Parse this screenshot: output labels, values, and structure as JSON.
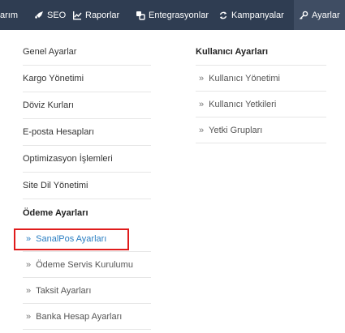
{
  "nav": {
    "items": [
      {
        "label": "arım",
        "icon": ""
      },
      {
        "label": "SEO",
        "icon": "rocket-icon"
      },
      {
        "label": "Raporlar",
        "icon": "chart-icon"
      },
      {
        "label": "Entegrasyonlar",
        "icon": "integration-icon"
      },
      {
        "label": "Kampanyalar",
        "icon": "refresh-icon"
      },
      {
        "label": "Ayarlar",
        "icon": "key-icon"
      }
    ]
  },
  "left_menu": {
    "items": [
      {
        "label": "Genel Ayarlar"
      },
      {
        "label": "Kargo Yönetimi"
      },
      {
        "label": "Döviz Kurları"
      },
      {
        "label": "E-posta Hesapları"
      },
      {
        "label": "Optimizasyon İşlemleri"
      },
      {
        "label": "Site Dil Yönetimi"
      }
    ],
    "group_title": "Ödeme Ayarları",
    "group_items": [
      {
        "label": "SanalPos Ayarları"
      },
      {
        "label": "Ödeme Servis Kurulumu"
      },
      {
        "label": "Taksit Ayarları"
      },
      {
        "label": "Banka Hesap Ayarları"
      }
    ]
  },
  "right_menu": {
    "title": "Kullanıcı Ayarları",
    "items": [
      {
        "label": "Kullanıcı Yönetimi"
      },
      {
        "label": "Kullanıcı Yetkileri"
      },
      {
        "label": "Yetki Grupları"
      }
    ]
  },
  "chevron": "»",
  "colors": {
    "topbar": "#2f3d52",
    "highlight": "#e01b1b",
    "link_active": "#2a7ec2"
  }
}
